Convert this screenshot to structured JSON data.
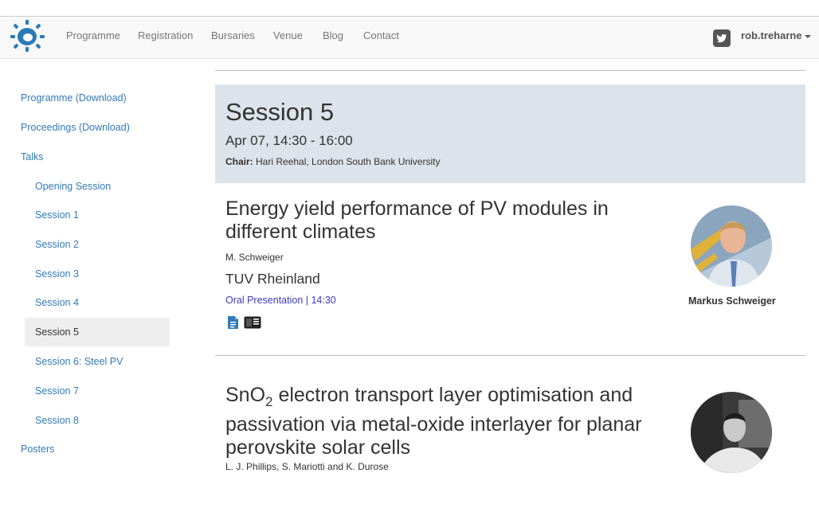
{
  "navbar": {
    "links": [
      "Programme",
      "Registration",
      "Bursaries",
      "Venue",
      "Blog",
      "Contact"
    ],
    "username": "rob.treharne",
    "twitter_icon": "twitter-icon",
    "logo_icon": "sun-logo-icon"
  },
  "sidebar": {
    "items": [
      {
        "label": "Programme (Download)"
      },
      {
        "label": "Proceedings (Download)"
      },
      {
        "label": "Talks"
      },
      {
        "label": "Opening Session"
      },
      {
        "label": "Session 1"
      },
      {
        "label": "Session 2"
      },
      {
        "label": "Session 3"
      },
      {
        "label": "Session 4"
      },
      {
        "label": "Session 5",
        "active": true
      },
      {
        "label": "Session 6: Steel PV"
      },
      {
        "label": "Session 7"
      },
      {
        "label": "Session 8"
      },
      {
        "label": "Posters"
      }
    ]
  },
  "session": {
    "title": "Session 5",
    "time": "Apr 07, 14:30 - 16:00",
    "chair_label": "Chair:",
    "chair": "Hari Reehal, London South Bank University"
  },
  "talks": [
    {
      "title": "Energy yield performance of PV modules in different climates",
      "authors": "M. Schweiger",
      "organisation": "TUV Rheinland",
      "meta": "Oral Presentation | 14:30",
      "speaker": "Markus Schweiger",
      "icons": [
        "document-icon",
        "book-icon"
      ]
    },
    {
      "title_prefix": "SnO",
      "title_sub": "2",
      "title_rest": " electron transport layer optimisation and passivation via metal-oxide interlayer for planar perovskite solar cells",
      "authors": "L. J. Phillips, S. Mariotti and K. Durose"
    }
  ],
  "colors": {
    "link": "#337ab7",
    "header_bg": "#dde3eb",
    "meta": "#3b3bbf",
    "logo": "#2a7ab8"
  }
}
